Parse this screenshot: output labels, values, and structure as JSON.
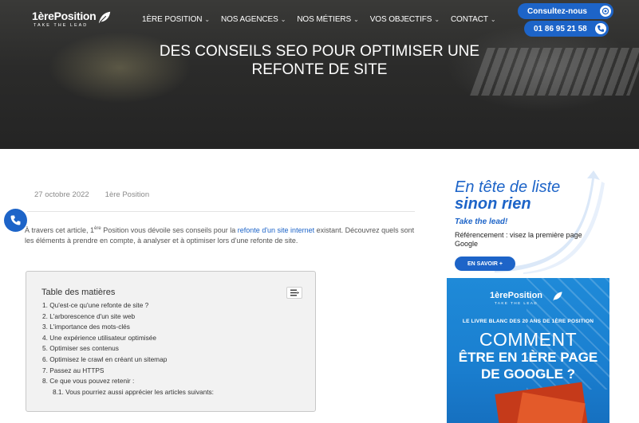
{
  "header": {
    "logo": {
      "brand": "1èrePosition",
      "tagline": "TAKE THE LEAD"
    },
    "nav": [
      {
        "label": "1ÈRE POSITION"
      },
      {
        "label": "NOS AGENCES"
      },
      {
        "label": "NOS MÉTIERS"
      },
      {
        "label": "VOS OBJECTIFS"
      },
      {
        "label": "CONTACT"
      }
    ],
    "consult_label": "Consultez-nous",
    "phone_label": "01 86 95 21 58"
  },
  "hero": {
    "title_line1": "DES CONSEILS SEO POUR OPTIMISER UNE",
    "title_line2": "REFONTE DE SITE"
  },
  "article": {
    "date": "27 octobre 2022",
    "author": "1ère Position",
    "intro_part1": "À travers cet article, 1",
    "intro_sup": "ère",
    "intro_part2": " Position vous dévoile ses conseils pour la ",
    "intro_link": "refonte d'un site internet",
    "intro_part3": " existant. Découvrez quels sont les éléments à prendre en compte, à analyser et à optimiser lors d'une refonte de site."
  },
  "toc": {
    "title": "Table des matières",
    "items": [
      "1. Qu'est-ce qu'une refonte de site ?",
      "2. L'arborescence d'un site web",
      "3. L'importance des mots-clés",
      "4. Une expérience utilisateur optimisée",
      "5. Optimiser ses contenus",
      "6. Optimisez le crawl en créant un sitemap",
      "7. Passez au HTTPS",
      "8. Ce que vous pouvez retenir :",
      "8.1. Vous pourriez aussi apprécier les articles suivants:"
    ]
  },
  "sidebar": {
    "ad1": {
      "line1": "En tête de liste",
      "line2": "sinon rien",
      "tagline": "Take the lead!",
      "description": "Référencement : visez la première page Google",
      "button": "EN SAVOIR +"
    },
    "ad2": {
      "brand": "1èrePosition",
      "brand_tag": "TAKE THE LEAD",
      "livre": "LE LIVRE BLANC DES 20 ANS DE 1ÈRE POSITION",
      "comment": "COMMENT",
      "line1": "ÊTRE EN 1ÈRE PAGE",
      "line2": "DE GOOGLE ?"
    }
  },
  "colors": {
    "accent": "#1d64c8",
    "hero_dark": "#2b2b2a"
  }
}
